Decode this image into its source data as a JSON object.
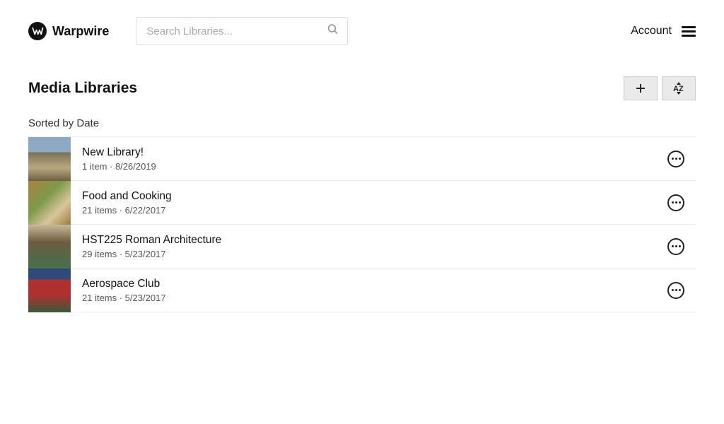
{
  "brand": "Warpwire",
  "search": {
    "placeholder": "Search Libraries..."
  },
  "account_label": "Account",
  "page_title": "Media Libraries",
  "sort_label": "Sorted by Date",
  "libraries": [
    {
      "title": "New Library!",
      "meta": "1 item · 8/26/2019"
    },
    {
      "title": "Food and Cooking",
      "meta": "21 items · 6/22/2017"
    },
    {
      "title": "HST225 Roman Architecture",
      "meta": "29 items · 5/23/2017"
    },
    {
      "title": "Aerospace Club",
      "meta": "21 items · 5/23/2017"
    }
  ]
}
